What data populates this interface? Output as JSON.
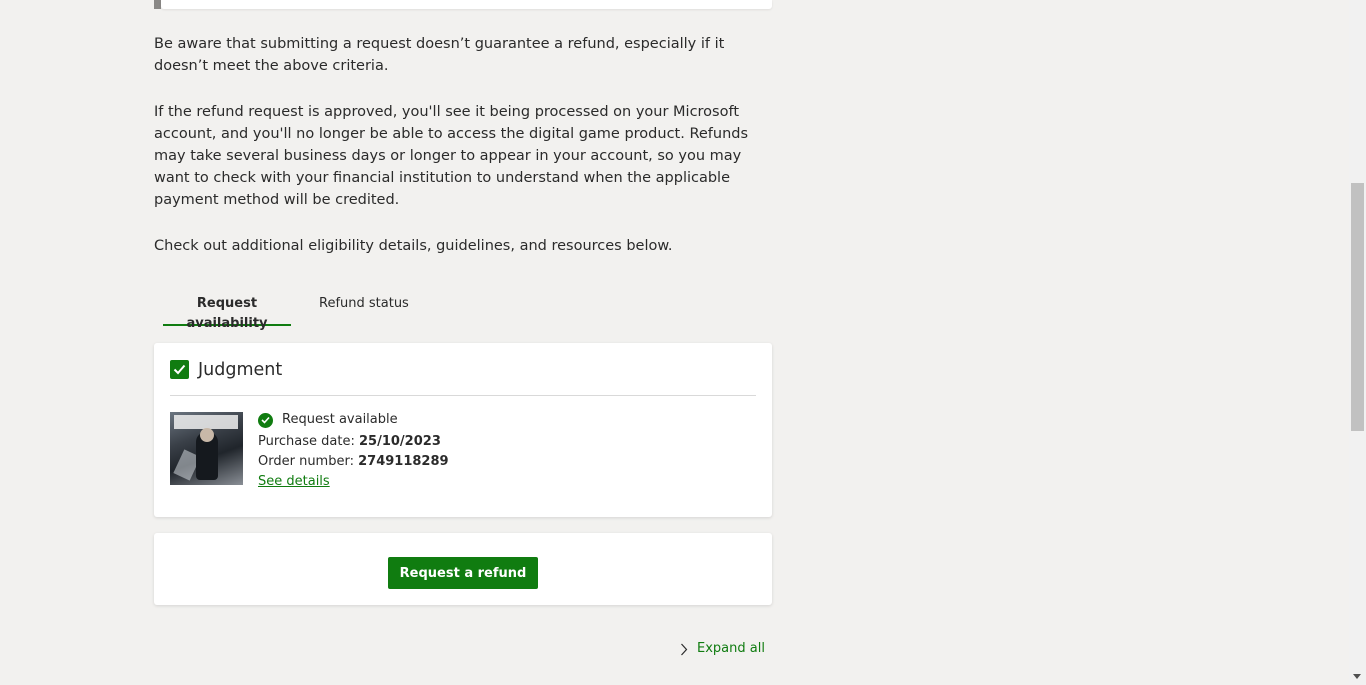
{
  "content": {
    "paragraphs": [
      "Be aware that submitting a request doesn’t guarantee a refund, especially if it doesn’t meet the above criteria.",
      "If the refund request is approved, you'll see it being processed on your Microsoft account, and you'll no longer be able to access the digital game product. Refunds may take several business days or longer to appear in your account, so you may want to check with your financial institution to understand when the applicable payment method will be credited.",
      "Check out additional eligibility details, guidelines, and resources below."
    ]
  },
  "tabs": [
    {
      "label": "Request availability",
      "active": true
    },
    {
      "label": "Refund status",
      "active": false
    }
  ],
  "product": {
    "title": "Judgment",
    "checked": true,
    "thumbnail_icon": "game-cover-image",
    "status": "Request available",
    "purchase_date_label": "Purchase date:",
    "purchase_date": "25/10/2023",
    "order_number_label": "Order number:",
    "order_number": "2749118289",
    "see_details": "See details"
  },
  "actions": {
    "request_refund": "Request a refund",
    "expand_all": "Expand all"
  },
  "colors": {
    "accent": "#107c10",
    "background": "#f2f1ef",
    "card": "#ffffff",
    "text": "#2b2b2b"
  }
}
